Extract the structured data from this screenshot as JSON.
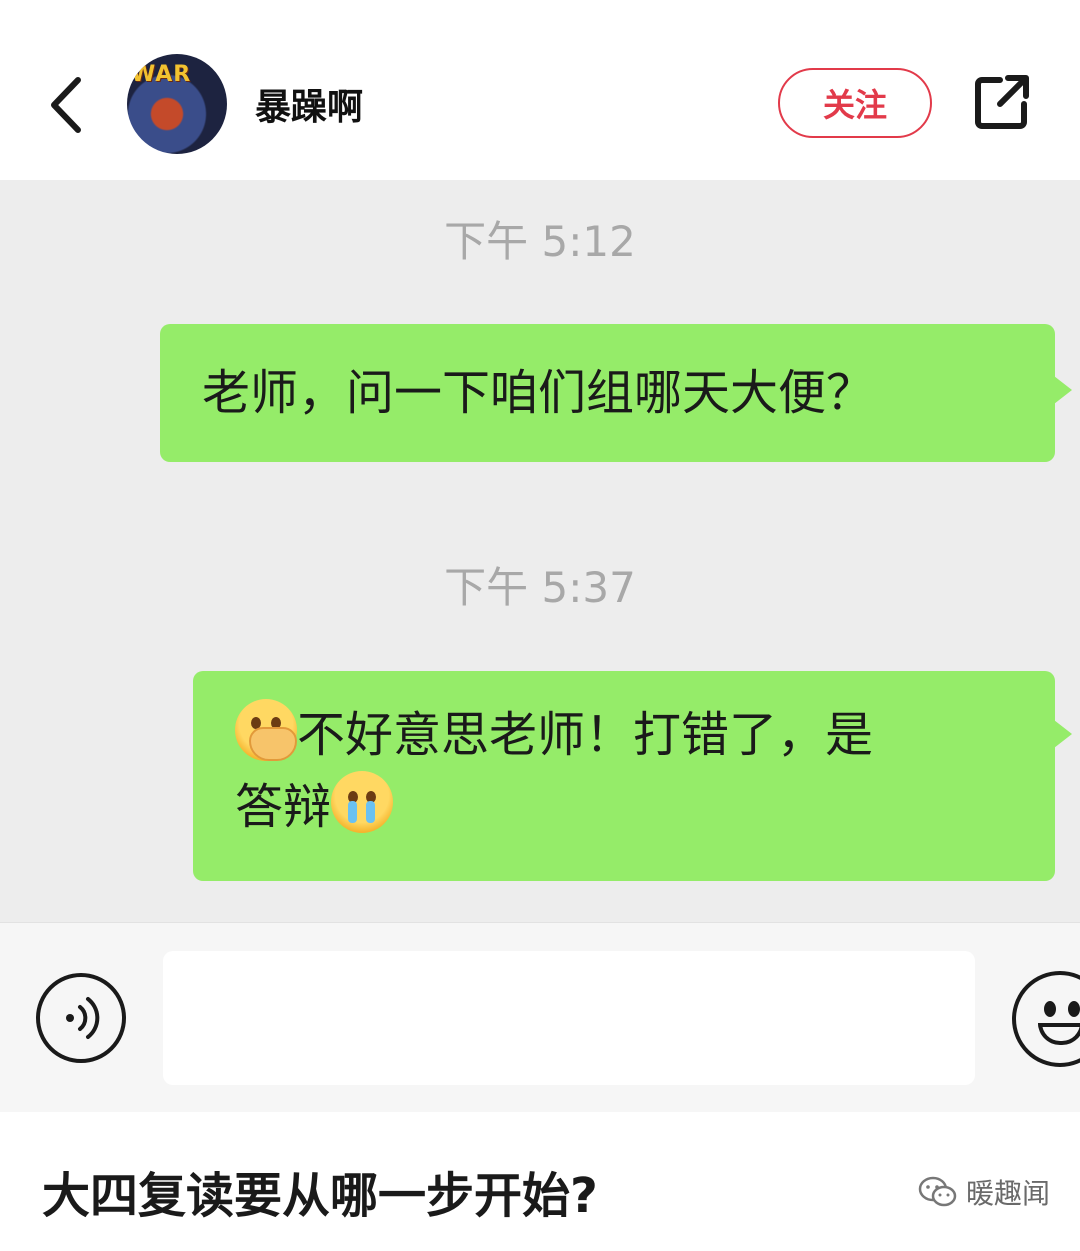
{
  "header": {
    "username": "暴躁啊",
    "follow_label": "关注",
    "avatar_text": "WAR"
  },
  "chat": {
    "messages": [
      {
        "time": "下午 5:12",
        "text": "老师，问一下咱们组哪天大便？"
      },
      {
        "time": "下午 5:37",
        "line1": "不好意思老师！打错了，是",
        "line2": "答辩"
      }
    ]
  },
  "input": {
    "value": "",
    "placeholder": ""
  },
  "caption": {
    "title": "大四复读要从哪一步开始?",
    "watermark": "暖趣闻"
  },
  "colors": {
    "bubble": "#95ec69",
    "follow": "#e23a4a",
    "chat_bg": "#ededed"
  }
}
